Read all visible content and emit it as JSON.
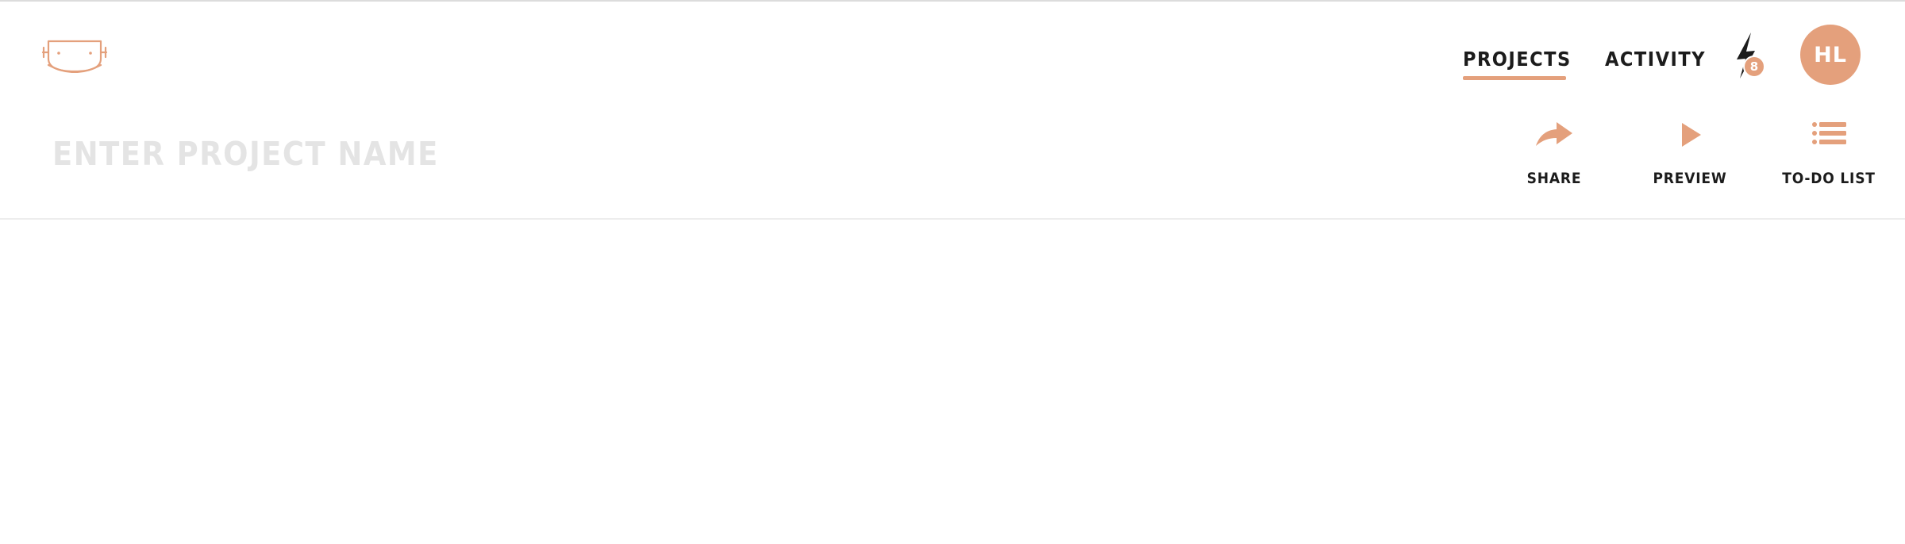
{
  "nav": {
    "projects_label": "PROJECTS",
    "activity_label": "ACTIVITY",
    "notification_count": "8",
    "avatar_initials": "HL",
    "active_tab": "PROJECTS"
  },
  "project": {
    "name_placeholder": "ENTER PROJECT NAME",
    "name_value": ""
  },
  "actions": {
    "share_label": "SHARE",
    "preview_label": "PREVIEW",
    "todo_label": "TO-DO LIST"
  },
  "icons": {
    "logo": "robot-face-logo",
    "notifications": "lightning-bolt-icon",
    "share": "share-arrow-icon",
    "preview": "play-icon",
    "todo": "list-icon"
  },
  "colors": {
    "accent": "#e4a07c",
    "text": "#1c1c1c",
    "placeholder": "#e4e4e4"
  }
}
